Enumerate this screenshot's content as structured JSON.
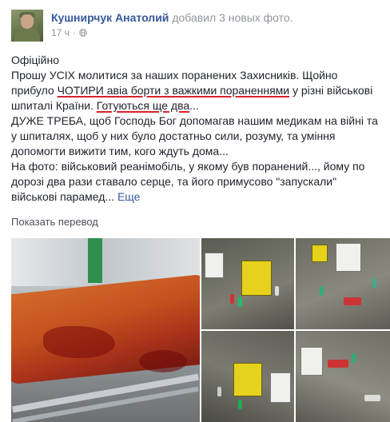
{
  "post": {
    "author": "Кушнирчук Анатолий",
    "action": "добавил 3 новых фото.",
    "time": "17 ч",
    "icons": {
      "visibility": "globe-icon",
      "avatar": "user-photo"
    },
    "paragraphs": {
      "p1": "Офіційно",
      "p2a": "Прошу УСІХ молитися за наших поранених Захисників. Щойно прибуло ",
      "p2b": "ЧОТИРИ авіа борти з важкими пораненнями",
      "p2c": " у різні військові шпиталі Країни. ",
      "p2d": "Готуються ще два",
      "p2e": "...",
      "p3": "ДУЖЕ ТРЕБА, щоб Господь Бог допомагав нашим медикам на війні та у шпиталях, щоб у них було достатньо сили, розуму, та уміння допомогти вижити тим, кого ждуть дома...",
      "p4": "На фото: військовий реанімобіль, у якому був поранений..., йому по дорозі два рази ставало серце, та його примусово \"запускали\" військові парамед... ",
      "more": "Еще"
    },
    "translate": "Показать перевод",
    "colors": {
      "link": "#365899",
      "underline": "#d8242c",
      "meta": "#90949c"
    }
  }
}
